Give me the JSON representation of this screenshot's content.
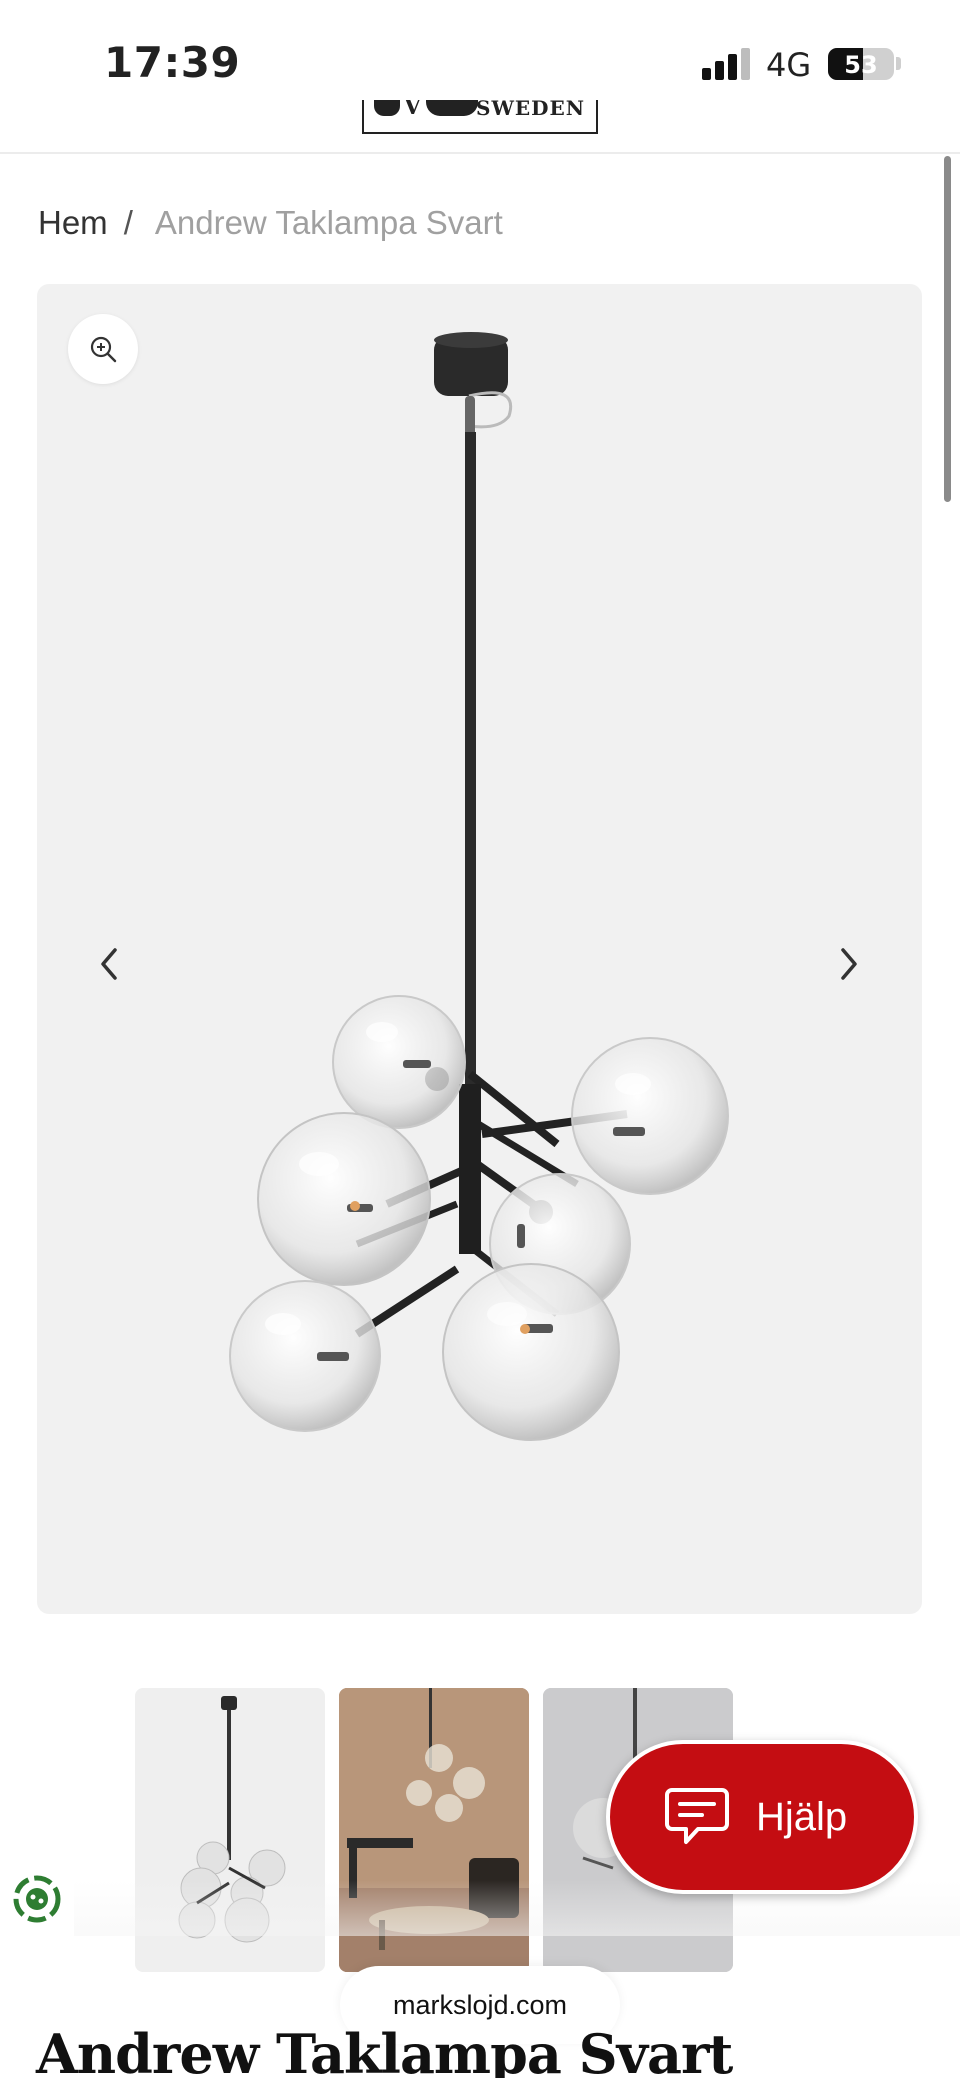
{
  "status_bar": {
    "time": "17:39",
    "network": "4G",
    "battery_percent": "53",
    "battery_level": 0.53,
    "signal_bars_active": 3,
    "signal_bars_total": 4
  },
  "header": {
    "logo_text": "SWEDEN"
  },
  "breadcrumb": {
    "home": "Hem",
    "separator": "/",
    "current": "Andrew Taklampa Svart"
  },
  "gallery": {
    "zoom_icon": "zoom-in-icon",
    "prev_icon": "chevron-left-icon",
    "next_icon": "chevron-right-icon",
    "background": "#f1f1f1"
  },
  "thumbnails": [
    {
      "name": "thumbnail-product-front"
    },
    {
      "name": "thumbnail-room-scene"
    },
    {
      "name": "thumbnail-detail"
    }
  ],
  "help_button": {
    "label": "Hjälp",
    "icon": "chat-icon",
    "color": "#c40d12"
  },
  "browser": {
    "url": "markslojd.com"
  },
  "product": {
    "title": "Andrew Taklampa Svart"
  }
}
